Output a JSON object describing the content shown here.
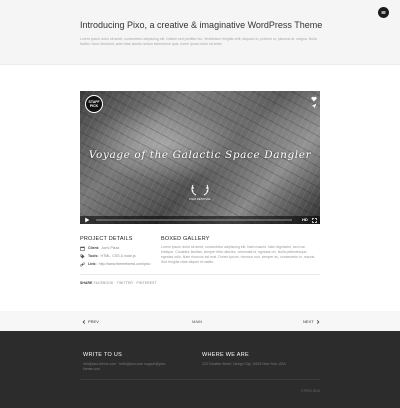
{
  "header": {
    "title": "Introducing Pixo, a creative & imaginative WordPress Theme",
    "intro": "Lorem ipsum dolor sit amet, consectetur adipiscing elit. Nullam sed porttitor leo. Vestibulum fringilla velit, aliquam in, pretium ut, placerat at, magna. Nulla facilisi. Nunc tincidunt, ante vitae iaculis nullam elementum quis, lorem ipsum dolor sit amet."
  },
  "video": {
    "badge": "STAFF PICK",
    "title": "Voyage of the Galactic Space Dangler",
    "award": "FILM FESTIVAL",
    "hd_label": "HD"
  },
  "project": {
    "heading": "PROJECT DETAILS",
    "details": [
      {
        "icon": "calendar-icon",
        "label": "Client:",
        "value": "Joe's Pizza"
      },
      {
        "icon": "tag-icon",
        "label": "Tools:",
        "value": "HTML, CSS & node.js"
      },
      {
        "icon": "link-icon",
        "label": "Link:",
        "value": "http://www.themeforest.com/pixo"
      }
    ]
  },
  "gallery": {
    "heading": "BOXED GALLERY",
    "text": "Lorem ipsum dolor sit amet, consectetur adipiscing elit. Nam mauris. Nam dignissim, sed non tristique. Curabitur facilisis, semper felis ultricies, venenatis id, egestas vel. Nulla pellentesque egestas odio. Nam rhoncus est erat. Donec ipsum, rhoncus non, semper ac, consectetur in, mauris. Sed fringilla vitae aliquet id mattis."
  },
  "tags": {
    "first": "SHARE",
    "rest": "FACEBOOK · TWITTER · PINTEREST"
  },
  "pager": {
    "prev": "PREV",
    "main": "MAIN",
    "next": "NEXT"
  },
  "footer": {
    "col1_heading": "WRITE TO US",
    "col1_text": "info@pixo-theme.com · hello@pixo.com support@pixo-theme.com",
    "col2_heading": "WHERE WE ARE",
    "col2_text": "123 Creative Street, Design City, 10001 New York, USA",
    "copyright": "© PIXO 2014"
  },
  "colors": {
    "footer_bg": "#2c2c2c",
    "header_bg": "#f5f5f5",
    "accent": "#1b1b1b"
  }
}
